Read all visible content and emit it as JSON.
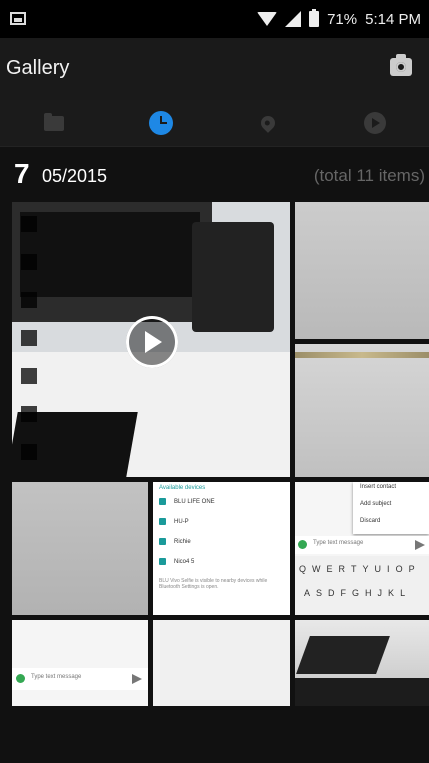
{
  "status_bar": {
    "battery": "71%",
    "time": "5:14 PM"
  },
  "app_bar": {
    "title": "Gallery",
    "camera_icon": "camera-icon"
  },
  "tabs": [
    {
      "name": "albums",
      "icon": "folder-icon",
      "active": false
    },
    {
      "name": "timeline",
      "icon": "clock-icon",
      "active": true
    },
    {
      "name": "places",
      "icon": "location-pin-icon",
      "active": false
    },
    {
      "name": "videos",
      "icon": "play-circle-icon",
      "active": false
    }
  ],
  "section": {
    "day": "7",
    "month_year": "05/2015",
    "total": "(total 11 items)"
  },
  "thumb_devices": {
    "title": "Available devices",
    "items": [
      "BLU LIFE ONE",
      "HU-P",
      "Richie",
      "Nico4 5"
    ],
    "footnote": "BLU Vivo Selfie is visible to nearby devices while Bluetooth Settings is open."
  },
  "thumb_menu": {
    "items": [
      "Insert contact",
      "Add subject",
      "Discard"
    ],
    "input_hint": "Type text message",
    "keyboard_row1": [
      "Q",
      "W",
      "E",
      "R",
      "T",
      "Y",
      "U",
      "I",
      "O",
      "P"
    ],
    "keyboard_row2": [
      "A",
      "S",
      "D",
      "F",
      "G",
      "H",
      "J",
      "K",
      "L"
    ]
  },
  "thumb_msg": {
    "input_hint": "Type text message"
  },
  "colors": {
    "accent": "#1e88e5",
    "background": "#111111"
  }
}
